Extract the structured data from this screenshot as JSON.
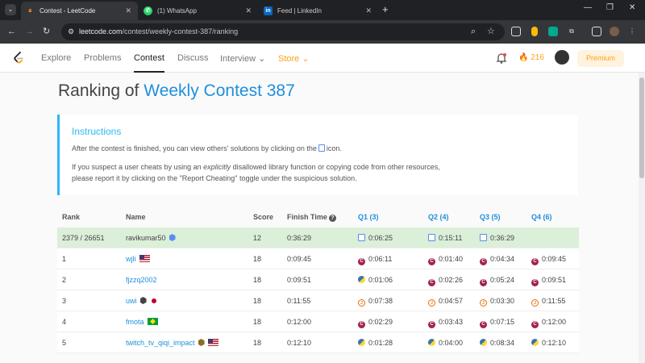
{
  "browser": {
    "tabs": [
      {
        "title": "Contest - LeetCode",
        "active": true
      },
      {
        "title": "(1) WhatsApp",
        "active": false
      },
      {
        "title": "Feed | LinkedIn",
        "active": false
      }
    ],
    "url_host": "leetcode.com",
    "url_path": "/contest/weekly-contest-387/ranking"
  },
  "lcnav": {
    "items": [
      "Explore",
      "Problems",
      "Contest",
      "Discuss",
      "Interview",
      "Store"
    ],
    "active": "Contest",
    "streak": "216",
    "premium": "Premium"
  },
  "page": {
    "title_prefix": "Ranking of",
    "title_link": "Weekly Contest 387"
  },
  "instructions": {
    "heading": "Instructions",
    "p1_before": "After the contest is finished, you can view others' solutions by clicking on the",
    "p1_after": "icon.",
    "p2_a": "If you suspect a user cheats by using an ",
    "p2_em": "explicitly",
    "p2_b": " disallowed library function or copying code from other resources,",
    "p2_c": "please report it by clicking on the \"Report Cheating\" toggle under the suspicious solution."
  },
  "table": {
    "headers": {
      "rank": "Rank",
      "name": "Name",
      "score": "Score",
      "finish": "Finish Time",
      "q1": "Q1 (3)",
      "q2": "Q2 (4)",
      "q3": "Q3 (5)",
      "q4": "Q4 (6)"
    },
    "rows": [
      {
        "rank": "2379 / 26651",
        "name": "ravikumar50",
        "score": "12",
        "finish": "0:36:29",
        "q1": "0:06:25",
        "q2": "0:15:11",
        "q3": "0:36:29",
        "q4": ""
      },
      {
        "rank": "1",
        "name": "wjli",
        "score": "18",
        "finish": "0:09:45",
        "q1": "0:06:11",
        "q2": "0:01:40",
        "q3": "0:04:34",
        "q4": "0:09:45"
      },
      {
        "rank": "2",
        "name": "fjzzq2002",
        "score": "18",
        "finish": "0:09:51",
        "q1": "0:01:06",
        "q2": "0:02:26",
        "q3": "0:05:24",
        "q4": "0:09:51"
      },
      {
        "rank": "3",
        "name": "uwi",
        "score": "18",
        "finish": "0:11:55",
        "q1": "0:07:38",
        "q2": "0:04:57",
        "q3": "0:03:30",
        "q4": "0:11:55"
      },
      {
        "rank": "4",
        "name": "fmota",
        "score": "18",
        "finish": "0:12:00",
        "q1": "0:02:29",
        "q2": "0:03:43",
        "q3": "0:07:15",
        "q4": "0:12:00"
      },
      {
        "rank": "5",
        "name": "twitch_tv_qiqi_impact",
        "score": "18",
        "finish": "0:12:10",
        "q1": "0:01:28",
        "q2": "0:04:00",
        "q3": "0:08:34",
        "q4": "0:12:10"
      }
    ]
  },
  "colors": {
    "accent": "#1e8fdd",
    "brand": "#ffa116",
    "highlight_row": "#dbefd9",
    "instructions_bar": "#2db7f5"
  }
}
